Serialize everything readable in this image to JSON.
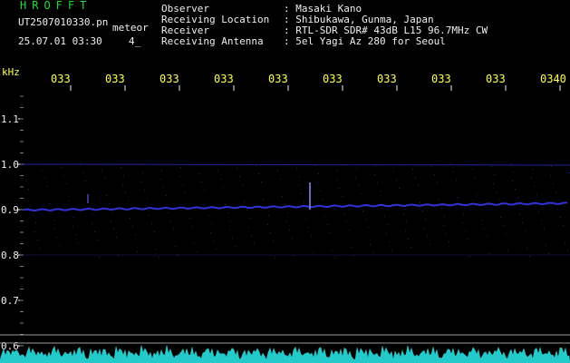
{
  "header": {
    "brand": "HROFFT",
    "file_name": "UT2507010330.pn",
    "event_tag": "meteor",
    "timestamp": "25.07.01 03:30",
    "sequence": "4_"
  },
  "station": {
    "observer_label": "Observer",
    "observer": ": Masaki Kano",
    "location_label": "Receiving Location",
    "location": ": Shibukawa, Gunma, Japan",
    "receiver_label": "Receiver",
    "receiver": ": RTL-SDR SDR# 43dB L15 96.7MHz CW",
    "antenna_label": "Receiving Antenna",
    "antenna": ": 5el Yagi Az 280 for Seoul"
  },
  "axis": {
    "unit": "kHz",
    "time_ticks": [
      "033",
      "033",
      "033",
      "033",
      "033",
      "033",
      "033",
      "033",
      "033",
      "0340"
    ],
    "freq_ticks": [
      "1.1",
      "1.0",
      "0.9",
      "0.8",
      "0.7",
      "0.6"
    ]
  },
  "colors": {
    "text": "#f0f0f0",
    "brand": "#1fdc3a",
    "axis_labels": "#ffff4a",
    "trace": "#3a3cff",
    "spectrum": "#28e0e0"
  }
}
